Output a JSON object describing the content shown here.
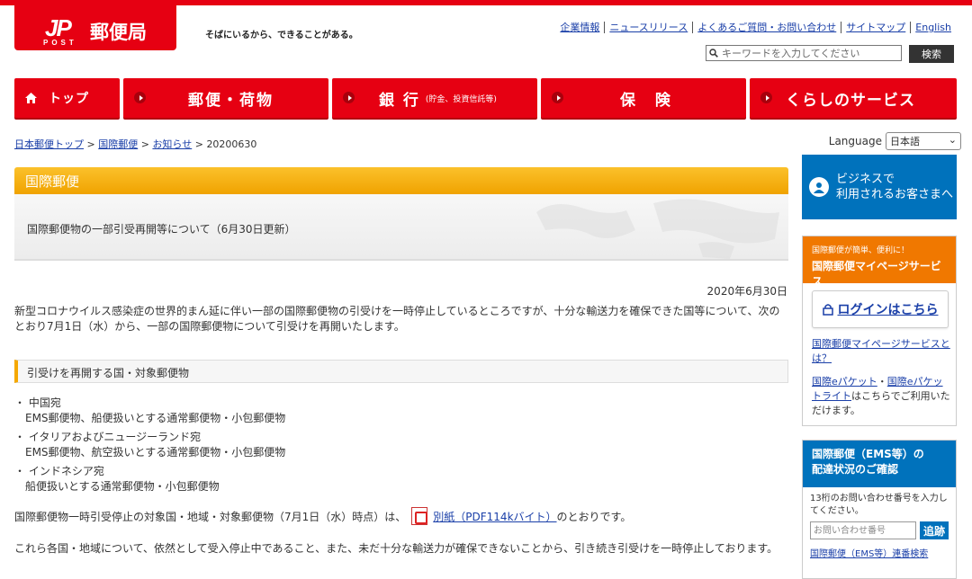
{
  "header": {
    "logo_mark": "JP",
    "logo_post": "POST",
    "logo_name": "郵便局",
    "tagline": "そばにいるから、できることがある。",
    "util_links": [
      "企業情報",
      "ニュースリリース",
      "よくあるご質問・お問い合わせ",
      "サイトマップ",
      "English"
    ],
    "search_placeholder": "キーワードを入力してください",
    "search_button": "検索"
  },
  "gnav": {
    "home": "トップ",
    "mail": "郵便・荷物",
    "bank": "銀 行",
    "bank_sub": "(貯金、投資信託等)",
    "insurance": "保 険",
    "life": "くらしのサービス"
  },
  "breadcrumb": {
    "items": [
      "日本郵便トップ",
      "国際郵便",
      "お知らせ"
    ],
    "current": "20200630",
    "sep": " > "
  },
  "language": {
    "label": "Language",
    "selected": "日本語"
  },
  "article": {
    "category": "国際郵便",
    "title": "国際郵便物の一部引受再開等について（6月30日更新）",
    "date": "2020年6月30日",
    "intro": "新型コロナウイルス感染症の世界的まん延に伴い一部の国際郵便物の引受けを一時停止しているところですが、十分な輸送力を確保できた国等について、次のとおり7月1日（水）から、一部の国際郵便物について引受けを再開いたします。",
    "section_heading": "引受けを再開する国・対象郵便物",
    "items": [
      {
        "country": "・ 中国宛",
        "detail": "EMS郵便物、船便扱いとする通常郵便物・小包郵便物"
      },
      {
        "country": "・ イタリアおよびニュージーランド宛",
        "detail": "EMS郵便物、航空扱いとする通常郵便物・小包郵便物"
      },
      {
        "country": "・ インドネシア宛",
        "detail": "船便扱いとする通常郵便物・小包郵便物"
      }
    ],
    "pdf_prefix": "国際郵便物一時引受停止の対象国・地域・対象郵便物（7月1日（水）時点）は、",
    "pdf_link": "別紙（PDF114kバイト）",
    "pdf_suffix": "のとおりです。",
    "closing": "これら各国・地域について、依然として受入停止中であること、また、未だ十分な輸送力が確保できないことから、引き続き引受けを一時停止しております。"
  },
  "sidebar": {
    "biz_line1": "ビジネスで",
    "biz_line2": "利用されるお客さまへ",
    "mypage_small": "国際郵便が簡単、便利に！",
    "mypage_title": "国際郵便マイページサービス",
    "login_label": "ログインはこちら",
    "link1": "国際郵便マイページサービスとは？",
    "link2a": "国際eパケット",
    "link2sep": "・",
    "link2b": "国際eパケットライト",
    "link2c": "はこちらでご利用いただけます。",
    "ems_title_1": "国際郵便（EMS等）の",
    "ems_title_2": "配達状況のご確認",
    "ems_desc": "13桁のお問い合わせ番号を入力してください。",
    "ems_placeholder": "お問い合わせ番号",
    "ems_button": "追跡",
    "ems_link": "国際郵便（EMS等）連番検索"
  },
  "colors": {
    "brand_red": "#e60012",
    "accent_orange": "#f0a300",
    "mypage_orange": "#f07800",
    "biz_blue": "#0072bc"
  }
}
